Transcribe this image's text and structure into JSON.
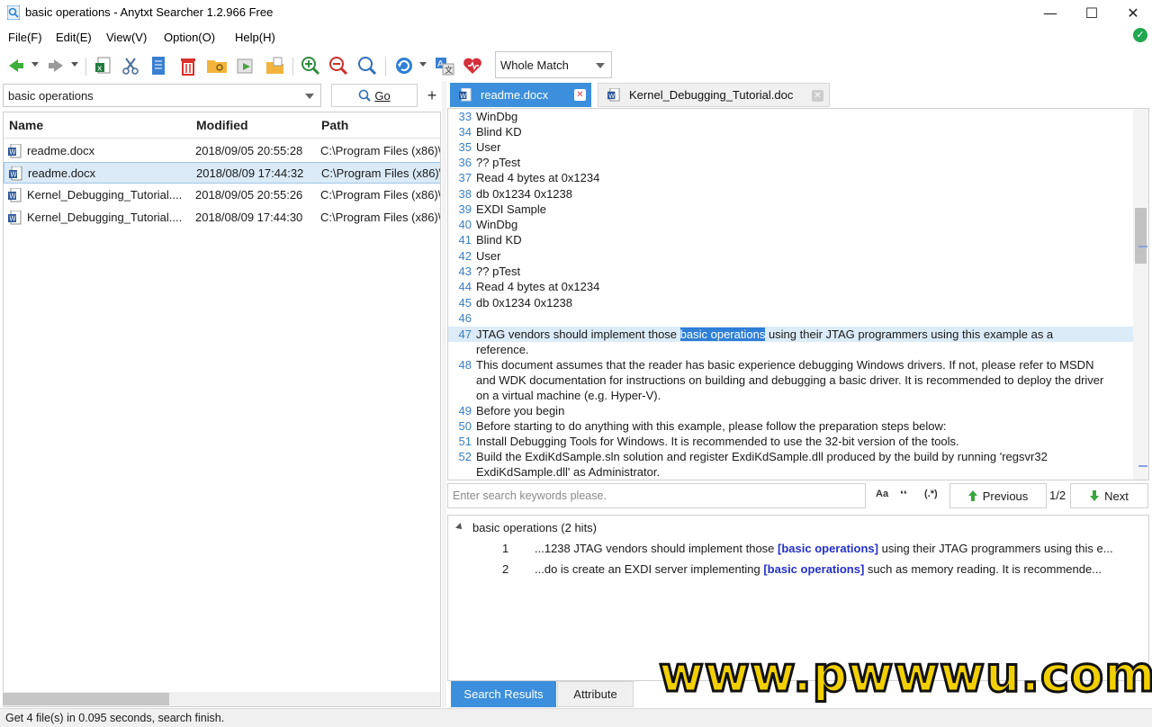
{
  "window": {
    "title": "basic operations - Anytxt Searcher 1.2.966 Free",
    "minimize": "—",
    "maximize": "☐",
    "close": "✕"
  },
  "menu": [
    "File(F)",
    "Edit(E)",
    "View(V)",
    "Option(O)",
    "Help(H)"
  ],
  "toolbar": {
    "match_mode": "Whole Match"
  },
  "search": {
    "query": "basic operations",
    "go_label": "Go",
    "add_label": "+"
  },
  "file_list": {
    "columns": [
      "Name",
      "Modified",
      "Path"
    ],
    "rows": [
      {
        "name": "readme.docx",
        "modified": "2018/09/05 20:55:28",
        "path": "C:\\Program Files (x86)\\"
      },
      {
        "name": "readme.docx",
        "modified": "2018/08/09 17:44:32",
        "path": "C:\\Program Files (x86)\\"
      },
      {
        "name": "Kernel_Debugging_Tutorial....",
        "modified": "2018/09/05 20:55:26",
        "path": "C:\\Program Files (x86)\\"
      },
      {
        "name": "Kernel_Debugging_Tutorial....",
        "modified": "2018/08/09 17:44:30",
        "path": "C:\\Program Files (x86)\\"
      }
    ]
  },
  "tabs": [
    {
      "label": "readme.docx"
    },
    {
      "label": "Kernel_Debugging_Tutorial.doc"
    }
  ],
  "document": {
    "lines": [
      {
        "n": "33",
        "t": "WinDbg"
      },
      {
        "n": "34",
        "t": "Blind KD"
      },
      {
        "n": "35",
        "t": "User"
      },
      {
        "n": "36",
        "t": "?? pTest"
      },
      {
        "n": "37",
        "t": "Read 4 bytes at 0x1234"
      },
      {
        "n": "38",
        "t": "db 0x1234 0x1238"
      },
      {
        "n": "39",
        "t": "EXDI Sample"
      },
      {
        "n": "40",
        "t": "WinDbg"
      },
      {
        "n": "41",
        "t": "Blind KD"
      },
      {
        "n": "42",
        "t": "User"
      },
      {
        "n": "43",
        "t": "?? pTest"
      },
      {
        "n": "44",
        "t": "Read 4 bytes at 0x1234"
      },
      {
        "n": "45",
        "t": "db 0x1234 0x1238"
      },
      {
        "n": "46",
        "t": ""
      }
    ],
    "line47": {
      "n": "47",
      "before": "JTAG vendors should implement those ",
      "hit": "basic operations",
      "after": " using their JTAG programmers using this example as a",
      "cont": "reference."
    },
    "line48": {
      "n": "48",
      "l1": "This document assumes that the reader has basic experience debugging Windows drivers. If not, please refer to MSDN",
      "l2": "and WDK documentation for instructions on building and debugging a basic driver. It is recommended to deploy the driver",
      "l3": "on a virtual machine (e.g. Hyper-V)."
    },
    "tail": [
      {
        "n": "49",
        "t": "Before you begin"
      },
      {
        "n": "50",
        "t": "Before starting to do anything with this example, please follow the preparation steps below:"
      },
      {
        "n": "51",
        "t": "Install Debugging Tools for Windows. It is recommended to use the 32-bit version of the tools."
      }
    ],
    "line52": {
      "n": "52",
      "l1": "Build the ExdiKdSample.sln solution and register ExdiKdSample.dll produced by the build by running 'regsvr32",
      "l2": "ExdiKdSample.dll' as Administrator."
    }
  },
  "find": {
    "placeholder": "Enter search keywords please.",
    "opt_case": "Aa",
    "opt_word": "❛❛",
    "opt_regex": "(.*)",
    "previous": "Previous",
    "page": "1/2",
    "next": "Next"
  },
  "results": {
    "header": "basic operations (2 hits)",
    "hits": [
      {
        "n": "1",
        "before": "...1238 JTAG vendors should implement those ",
        "hit": "[basic operations]",
        "after": " using their JTAG programmers using this e..."
      },
      {
        "n": "2",
        "before": "...do is create an EXDI server implementing ",
        "hit": "[basic operations]",
        "after": " such as memory reading. It is recommende..."
      }
    ]
  },
  "bottom_tabs": [
    "Search Results",
    "Attribute"
  ],
  "status": "Get 4 file(s) in 0.095 seconds, search finish.",
  "watermark": "www.pwwwu.com",
  "colors": {
    "accent": "#3c8fdc",
    "hit_bg": "#2f7fd6",
    "hit_text": "#2431c6",
    "ok": "#1fa84f"
  }
}
